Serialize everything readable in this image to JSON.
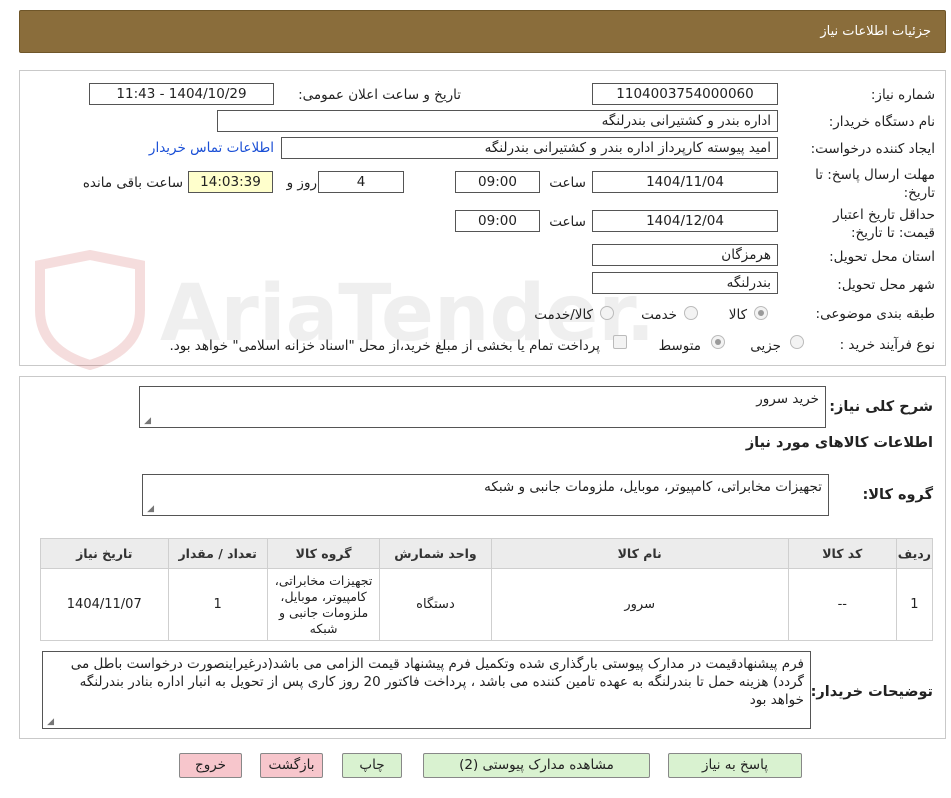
{
  "header": {
    "title": "جزئیات اطلاعات نیاز"
  },
  "form": {
    "need_number_label": "شماره نیاز:",
    "need_number": "1104003754000060",
    "announce_label": "تاریخ و ساعت اعلان عمومی:",
    "announce_value": "1404/10/29 - 11:43",
    "buyer_org_label": "نام دستگاه خریدار:",
    "buyer_org": "اداره بندر و کشتیرانی بندرلنگه",
    "creator_label": "ایجاد کننده درخواست:",
    "creator": "امید پیوسته کارپرداز اداره بندر و کشتیرانی بندرلنگه",
    "contact_link": "اطلاعات تماس خریدار",
    "deadline_label": "مهلت ارسال پاسخ: تا تاریخ:",
    "deadline_date": "1404/11/04",
    "time_label": "ساعت",
    "deadline_time": "09:00",
    "days_value": "4",
    "days_label": "روز و",
    "remaining_time": "14:03:39",
    "remaining_label": "ساعت باقی مانده",
    "validity_label": "حداقل تاریخ اعتبار قیمت: تا تاریخ:",
    "validity_date": "1404/12/04",
    "validity_time": "09:00",
    "province_label": "استان محل تحویل:",
    "province": "هرمزگان",
    "city_label": "شهر محل تحویل:",
    "city": "بندرلنگه",
    "category_label": "طبقه بندی موضوعی:",
    "category_options": [
      "کالا",
      "خدمت",
      "کالا/خدمت"
    ],
    "process_label": "نوع فرآیند خرید :",
    "process_options": [
      "جزیی",
      "متوسط"
    ],
    "payment_note": "پرداخت تمام یا بخشی از مبلغ خرید،از محل \"اسناد خزانه اسلامی\" خواهد بود."
  },
  "watermark": {
    "text": "AriaTender.neT"
  },
  "need": {
    "summary_label": "شرح کلی نیاز:",
    "summary": "خرید سرور",
    "goods_info_title": "اطلاعات کالاهای مورد نیاز",
    "goods_group_label": "گروه کالا:",
    "goods_group": "تجهیزات مخابراتی، کامپیوتر، موبایل، ملزومات جانبی و شبکه"
  },
  "table": {
    "headers": [
      "ردیف",
      "کد کالا",
      "نام کالا",
      "واحد شمارش",
      "گروه کالا",
      "تعداد / مقدار",
      "تاریخ نیاز"
    ],
    "rows": [
      [
        "1",
        "--",
        "سرور",
        "دستگاه",
        "تجهیزات مخابراتی، کامپیوتر، موبایل، ملزومات جانبی و شبکه",
        "1",
        "1404/11/07"
      ]
    ]
  },
  "buyer_notes": {
    "label": "توضیحات خریدار:",
    "text": "فرم پیشنهادقیمت در مدارک پیوستی بارگذاری شده وتکمیل فرم پیشنهاد قیمت الزامی می باشد(درغیراینصورت درخواست باطل می گردد) هزینه حمل تا بندرلنگه به عهده تامین کننده می باشد ، پرداخت فاکتور 20 روز کاری پس از تحویل به انبار اداره بنادر بندرلنگه خواهد بود"
  },
  "buttons": {
    "reply": "پاسخ به نیاز",
    "attachments": "مشاهده مدارک پیوستی (2)",
    "print": "چاپ",
    "back": "بازگشت",
    "exit": "خروج"
  },
  "colors": {
    "header_bg": "#8a6d3b",
    "button_green": "#d9f2d0",
    "button_pink": "#f7c6cc"
  }
}
